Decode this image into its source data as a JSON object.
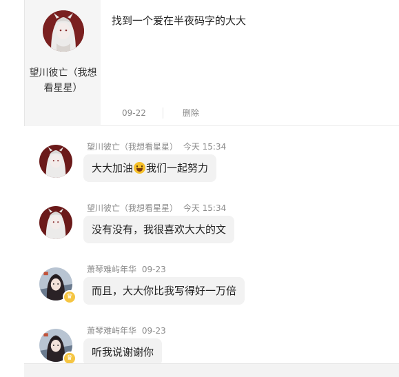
{
  "post": {
    "author_name": "望川彼亡（我想看星星）",
    "content": "找到一个爱在半夜码字的大大",
    "date": "09-22",
    "delete_label": "删除"
  },
  "comments": [
    {
      "author": "望川彼亡（我想看星星）",
      "time": "今天 15:34",
      "text_before": "大大加油",
      "emoji": "grinning-face",
      "text_after": "我们一起努力",
      "avatar": "white-hair-anime-avatar"
    },
    {
      "author": "望川彼亡（我想看星星）",
      "time": "今天 15:34",
      "text": "没有没有，我很喜欢大大的文",
      "avatar": "white-hair-anime-avatar"
    },
    {
      "author": "萧琴难屿年华",
      "time": "09-23",
      "text": "而且，大大你比我写得好一万倍",
      "avatar": "dark-hair-anime-avatar",
      "badge": "crown-badge"
    },
    {
      "author": "萧琴难屿年华",
      "time": "09-23",
      "text": "听我说谢谢你",
      "avatar": "dark-hair-anime-avatar",
      "badge": "crown-badge"
    }
  ],
  "colors": {
    "bubble_bg": "#f2f2f2",
    "author_panel_bg": "#f5f5f5",
    "meta_text": "#8a8a8a",
    "badge": "#f5c542"
  }
}
